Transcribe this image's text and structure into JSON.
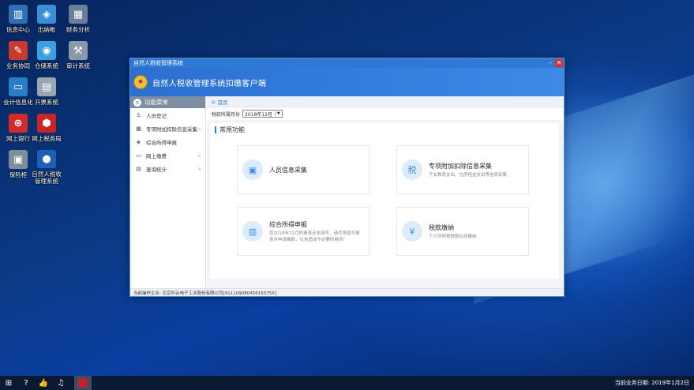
{
  "desktop": {
    "icons": [
      {
        "label": "信息中心",
        "icon": "info-center-icon",
        "color": "#2f6fb6",
        "glyph": "▥"
      },
      {
        "label": "出纳帐",
        "icon": "cashier-icon",
        "color": "#3b8fd6",
        "glyph": "◈"
      },
      {
        "label": "财务分析",
        "icon": "finance-analysis-icon",
        "color": "#6a7f95",
        "glyph": "▦"
      },
      {
        "label": "业务协同",
        "icon": "business-collab-icon",
        "color": "#c93a2e",
        "glyph": "✎"
      },
      {
        "label": "仓储系统",
        "icon": "warehouse-icon",
        "color": "#3aa0e0",
        "glyph": "◉"
      },
      {
        "label": "审计系统",
        "icon": "audit-icon",
        "color": "#8a98a8",
        "glyph": "⚒"
      },
      {
        "label": "会计信息化",
        "icon": "accounting-icon",
        "color": "#2a7ec8",
        "glyph": "▭"
      },
      {
        "label": "开票系统",
        "icon": "invoice-icon",
        "color": "#9aa6b2",
        "glyph": "▤"
      },
      {
        "label": "网上银行",
        "icon": "online-bank-icon",
        "color": "#d42a2a",
        "glyph": "⊛"
      },
      {
        "label": "网上税务局",
        "icon": "online-tax-icon",
        "color": "#c92525",
        "glyph": "⬢"
      },
      {
        "label": "保险柜",
        "icon": "safe-icon",
        "color": "#7f8c99",
        "glyph": "▣"
      },
      {
        "label": "自然人税收\n管理系统",
        "icon": "personal-tax-icon",
        "color": "#1f5fb8",
        "glyph": "●"
      }
    ]
  },
  "window": {
    "title": "自然人税收管理系统",
    "app_title": "自然人税收管理系统扣缴客户端",
    "sidebar": {
      "header": "功能菜单",
      "items": [
        {
          "label": "人员登记",
          "icon": "person-icon",
          "glyph": "♙",
          "has_children": false
        },
        {
          "label": "专项附加扣除信息采集",
          "icon": "grid-icon",
          "glyph": "▦",
          "has_children": true
        },
        {
          "label": "综合所得申报",
          "icon": "layers-icon",
          "glyph": "◈",
          "has_children": false
        },
        {
          "label": "网上缴费",
          "icon": "folder-icon",
          "glyph": "▭",
          "has_children": true
        },
        {
          "label": "查询统计",
          "icon": "chart-icon",
          "glyph": "▤",
          "has_children": true
        }
      ]
    },
    "breadcrumb": "首页",
    "filter": {
      "label": "税款所属月份",
      "value": "2018年12月"
    },
    "panel_title": "常用功能",
    "cards": [
      {
        "title": "人员信息采集",
        "desc": "",
        "icon": "person-card-icon",
        "glyph": "▣"
      },
      {
        "title": "专项附加扣除信息采集",
        "desc": "子女教育支出、住房租金支出等信息采集",
        "icon": "tax-form-icon",
        "glyph": "税"
      },
      {
        "title": "综合所得申报",
        "desc": "您2018年12月的报表还未填写，请尽快填写报表并申请缴款，以免造成不必要的麻烦！",
        "icon": "report-icon",
        "glyph": "▥"
      },
      {
        "title": "税款缴纳",
        "desc": "个人所得税税款在线缴纳",
        "icon": "yen-icon",
        "glyph": "¥"
      }
    ],
    "status": "当前操作企业:  北京科云电子工业股份有限公司[91110908045615075X]"
  },
  "taskbar": {
    "date_text": "当前业务日期: 2019年1月2日"
  }
}
